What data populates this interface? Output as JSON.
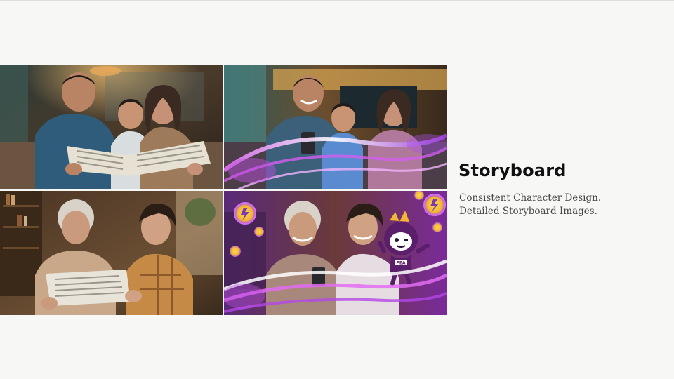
{
  "slide": {
    "title": "Storyboard",
    "description_lines": [
      "Consistent Character Design.",
      "Detailed Storyboard Images."
    ]
  },
  "storyboard_panels": [
    {
      "id": "panel-1",
      "scene": "family-reading-newspaper"
    },
    {
      "id": "panel-2",
      "scene": "family-smiling-with-phone-magic"
    },
    {
      "id": "panel-3",
      "scene": "grandmother-and-grandson-reading-paper"
    },
    {
      "id": "panel-4",
      "scene": "grandmother-and-grandson-phone-mascot"
    }
  ],
  "mascot": {
    "badge_text": "PEA"
  },
  "colors": {
    "background": "#f7f7f5",
    "title": "#111111",
    "body_text": "#444444",
    "magic_purple": "#b347e6",
    "coin_gold": "#f2b632"
  }
}
